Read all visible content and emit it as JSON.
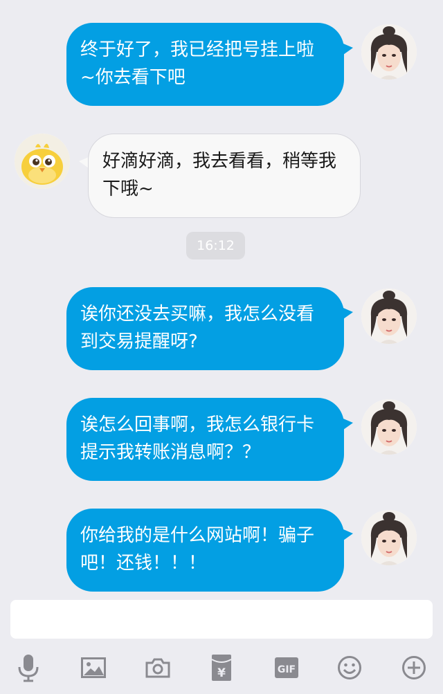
{
  "messages": [
    {
      "side": "out",
      "text": "终于好了，我已经把号挂上啦~你去看下吧",
      "avatar": "girl-avatar"
    },
    {
      "side": "in",
      "text": "好滴好滴，我去看看，稍等我下哦~",
      "avatar": "yellow-bird-avatar"
    },
    {
      "side": "out",
      "text": "诶你还没去买嘛，我怎么没看到交易提醒呀?",
      "avatar": "girl-avatar"
    },
    {
      "side": "out",
      "text": "诶怎么回事啊，我怎么银行卡提示我转账消息啊？？",
      "avatar": "girl-avatar"
    },
    {
      "side": "out",
      "text": "你给我的是什么网站啊！骗子吧！还钱！！！",
      "avatar": "girl-avatar"
    }
  ],
  "timestamp": "16:12",
  "composer": {
    "value": ""
  },
  "toolbar": {
    "icons": [
      "microphone-icon",
      "image-icon",
      "camera-icon",
      "red-packet-icon",
      "gif-icon",
      "emoji-icon",
      "plus-icon"
    ],
    "gif_label": "GIF",
    "yuan_symbol": "¥"
  },
  "colors": {
    "outgoing_bubble": "#039fe3",
    "incoming_bubble": "#f8f8f8",
    "background": "#ececf1",
    "icon": "#8a8a90"
  }
}
